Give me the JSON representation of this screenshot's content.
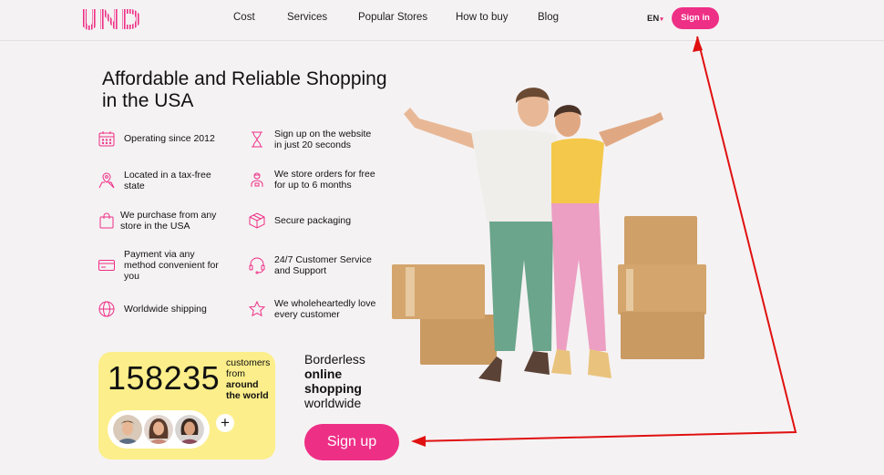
{
  "header": {
    "logo": "UND",
    "nav": [
      "Cost",
      "Services",
      "Popular Stores",
      "How to buy",
      "Blog"
    ],
    "lang": "EN",
    "signin": "Sign in"
  },
  "hero": {
    "title": "Affordable and Reliable Shopping in the USA",
    "features": [
      {
        "icon": "calendar-icon",
        "text": "Operating since 2012"
      },
      {
        "icon": "hourglass-icon",
        "text": "Sign up on the website in just 20 seconds"
      },
      {
        "icon": "map-pin-icon",
        "text": "Located in a tax-free state"
      },
      {
        "icon": "warehouse-worker-icon",
        "text": "We store orders for free for up to 6 months"
      },
      {
        "icon": "shopping-bag-icon",
        "text": "We purchase from any store in the USA"
      },
      {
        "icon": "package-icon",
        "text": "Secure packaging"
      },
      {
        "icon": "credit-card-icon",
        "text": "Payment via any method convenient for you"
      },
      {
        "icon": "headset-icon",
        "text": "24/7 Customer Service and Support"
      },
      {
        "icon": "globe-icon",
        "text": "Worldwide shipping"
      },
      {
        "icon": "star-icon",
        "text": "We wholeheartedly love every customer"
      }
    ]
  },
  "stats": {
    "count": "158235",
    "line1": "customers",
    "line2": "from",
    "line3": "around",
    "line4": "the world",
    "plus": "+"
  },
  "tagline": {
    "line1": "Borderless",
    "line2": "online",
    "line3": "shopping",
    "line4": "worldwide"
  },
  "cta": {
    "signup": "Sign up"
  },
  "colors": {
    "accent": "#ee2f86",
    "stats_bg": "#fcee8a",
    "annotation": "#e01010"
  }
}
